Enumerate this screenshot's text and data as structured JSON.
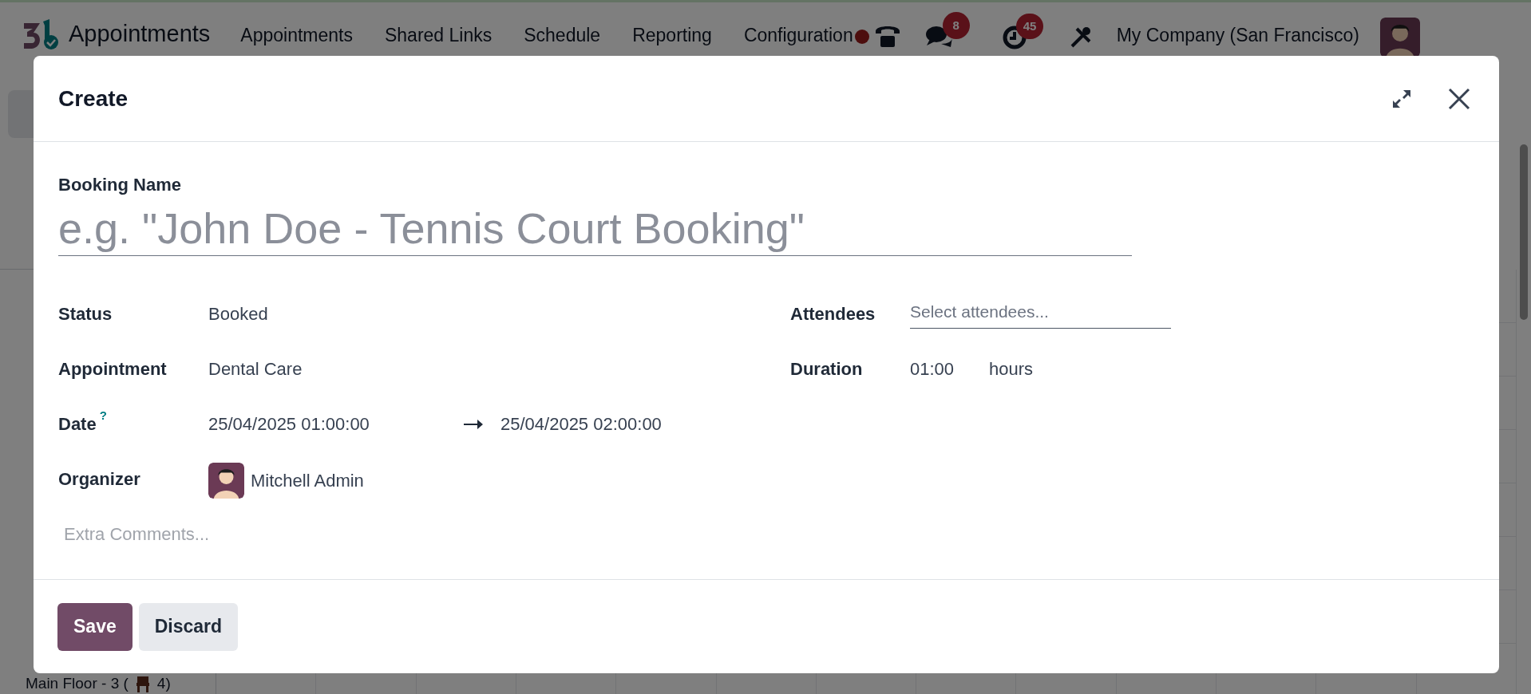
{
  "navbar": {
    "app_name": "Appointments",
    "menu": [
      "Appointments",
      "Shared Links",
      "Schedule",
      "Reporting",
      "Configuration"
    ],
    "chat_count": "8",
    "activity_count": "45",
    "company": "My Company (San Francisco)"
  },
  "background": {
    "last_row": {
      "before": "Main Floor - 3 (",
      "after": "4)"
    }
  },
  "dialog": {
    "title": "Create",
    "booking_name": {
      "label": "Booking Name",
      "placeholder": "e.g. \"John Doe - Tennis Court Booking\""
    },
    "left_fields": [
      {
        "kind": "text",
        "label": "Status",
        "value": "Booked"
      },
      {
        "kind": "text",
        "label": "Appointment",
        "value": "Dental Care"
      },
      {
        "kind": "range",
        "label": "Date",
        "help": "?",
        "start": "25/04/2025 01:00:00",
        "end": "25/04/2025 02:00:00"
      },
      {
        "kind": "user",
        "label": "Organizer",
        "value": "Mitchell Admin"
      }
    ],
    "right_fields": [
      {
        "kind": "input",
        "label": "Attendees",
        "placeholder": "Select attendees..."
      },
      {
        "kind": "duration",
        "label": "Duration",
        "value": "01:00",
        "unit": "hours"
      }
    ],
    "comments_placeholder": "Extra Comments...",
    "buttons": [
      {
        "kind": "primary",
        "label": "Save"
      },
      {
        "kind": "secondary",
        "label": "Discard"
      }
    ]
  }
}
